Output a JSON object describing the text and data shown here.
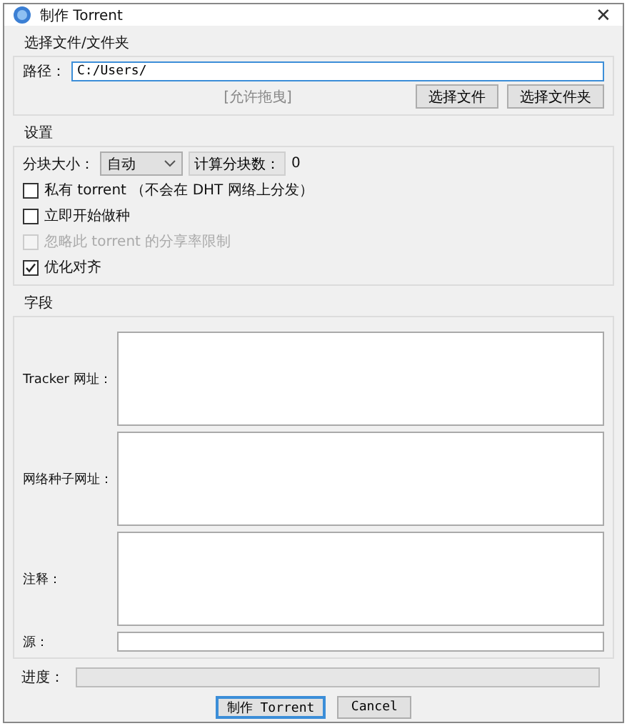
{
  "window": {
    "title": "制作 Torrent",
    "close": "✕"
  },
  "file_group": {
    "title": "选择文件/文件夹",
    "path_label": "路径：",
    "path_value": "C:/Users/",
    "drop_hint": "[允许拖曳]",
    "buttons": [
      "选择文件",
      "选择文件夹"
    ]
  },
  "settings_group": {
    "title": "设置",
    "piece_size_label": "分块大小：",
    "piece_size_value": "自动",
    "calc_button": "计算分块数：",
    "piece_count": "0",
    "options": [
      {
        "label": "私有 torrent （不会在 DHT 网络上分发）",
        "checked": false,
        "disabled": false
      },
      {
        "label": "立即开始做种",
        "checked": false,
        "disabled": false
      },
      {
        "label": "忽略此 torrent 的分享率限制",
        "checked": false,
        "disabled": true
      },
      {
        "label": "优化对齐",
        "checked": true,
        "disabled": false
      }
    ]
  },
  "fields_group": {
    "title": "字段",
    "fields": [
      {
        "label": "Tracker 网址：",
        "kind": "multiline"
      },
      {
        "label": "网络种子网址：",
        "kind": "multiline"
      },
      {
        "label": "注释：",
        "kind": "multiline"
      },
      {
        "label": "源：",
        "kind": "line"
      }
    ]
  },
  "progress": {
    "label": "进度：",
    "level": 0
  },
  "buttons": [
    {
      "label": "制作 Torrent",
      "selected": true
    },
    {
      "label": "Cancel",
      "selected": false
    }
  ]
}
